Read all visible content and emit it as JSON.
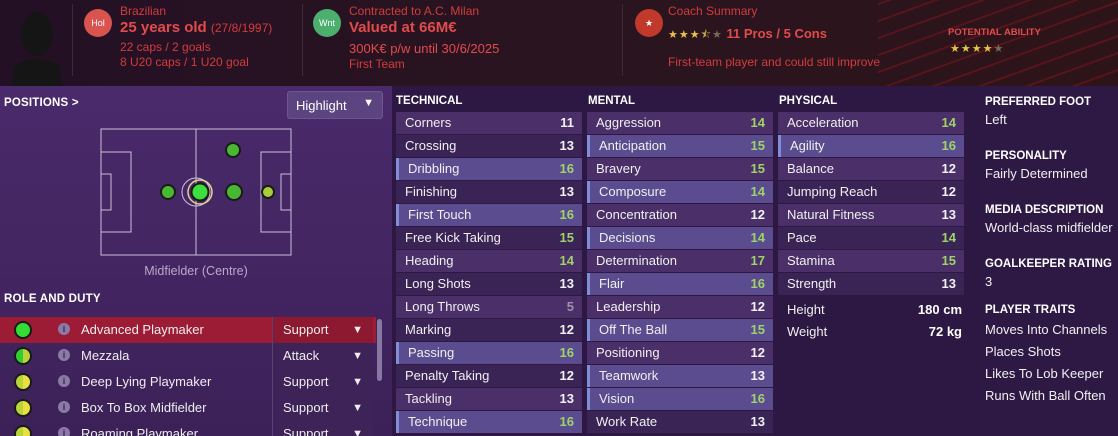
{
  "header": {
    "nation": {
      "badge": "Hol",
      "nationality": "Brazilian",
      "age": "25 years old",
      "dob": "(27/8/1997)",
      "caps": "22 caps / 2 goals",
      "u20": "8 U20 caps / 1 U20 goal"
    },
    "contract": {
      "badge": "Wnt",
      "status": "Contracted to A.C. Milan",
      "value": "Valued at 66M€",
      "wage": "300K€ p/w until 30/6/2025",
      "squad": "First Team"
    },
    "coach": {
      "title": "Coach Summary",
      "stars": 3.5,
      "pros_cons": "11 Pros / 5 Cons",
      "summary": "First-team player and could still improve"
    },
    "potential": {
      "label": "POTENTIAL ABILITY",
      "stars": 4
    },
    "colors": {
      "accent_red": "#e24b4b",
      "nation_badge": "#d9534f",
      "contract_badge": "#4caf6e"
    }
  },
  "positions": {
    "title": "POSITIONS >",
    "highlight_label": "Highlight",
    "caption": "Midfielder (Centre)"
  },
  "role_duty": {
    "title": "ROLE AND DUTY",
    "roles": [
      {
        "name": "Advanced Playmaker",
        "duty": "Support",
        "selected": true
      },
      {
        "name": "Mezzala",
        "duty": "Attack"
      },
      {
        "name": "Deep Lying Playmaker",
        "duty": "Support"
      },
      {
        "name": "Box To Box Midfielder",
        "duty": "Support"
      },
      {
        "name": "Roaming Playmaker",
        "duty": "Support"
      }
    ]
  },
  "attributes": {
    "technical": {
      "title": "TECHNICAL",
      "items": [
        {
          "name": "Corners",
          "value": "11"
        },
        {
          "name": "Crossing",
          "value": "13"
        },
        {
          "name": "Dribbling",
          "value": "16",
          "highlight": true
        },
        {
          "name": "Finishing",
          "value": "13"
        },
        {
          "name": "First Touch",
          "value": "16",
          "highlight": true
        },
        {
          "name": "Free Kick Taking",
          "value": "15"
        },
        {
          "name": "Heading",
          "value": "14"
        },
        {
          "name": "Long Shots",
          "value": "13"
        },
        {
          "name": "Long Throws",
          "value": "5"
        },
        {
          "name": "Marking",
          "value": "12"
        },
        {
          "name": "Passing",
          "value": "16",
          "highlight": true
        },
        {
          "name": "Penalty Taking",
          "value": "12"
        },
        {
          "name": "Tackling",
          "value": "13"
        },
        {
          "name": "Technique",
          "value": "16",
          "highlight": true
        }
      ]
    },
    "mental": {
      "title": "MENTAL",
      "items": [
        {
          "name": "Aggression",
          "value": "14"
        },
        {
          "name": "Anticipation",
          "value": "15",
          "highlight": true
        },
        {
          "name": "Bravery",
          "value": "15"
        },
        {
          "name": "Composure",
          "value": "14",
          "highlight": true
        },
        {
          "name": "Concentration",
          "value": "12"
        },
        {
          "name": "Decisions",
          "value": "14",
          "highlight": true
        },
        {
          "name": "Determination",
          "value": "17"
        },
        {
          "name": "Flair",
          "value": "16",
          "highlight": true
        },
        {
          "name": "Leadership",
          "value": "12"
        },
        {
          "name": "Off The Ball",
          "value": "15",
          "highlight": true
        },
        {
          "name": "Positioning",
          "value": "12"
        },
        {
          "name": "Teamwork",
          "value": "13",
          "highlight": true
        },
        {
          "name": "Vision",
          "value": "16",
          "highlight": true
        },
        {
          "name": "Work Rate",
          "value": "13"
        }
      ]
    },
    "physical": {
      "title": "PHYSICAL",
      "items": [
        {
          "name": "Acceleration",
          "value": "14"
        },
        {
          "name": "Agility",
          "value": "16",
          "highlight": true
        },
        {
          "name": "Balance",
          "value": "12"
        },
        {
          "name": "Jumping Reach",
          "value": "12"
        },
        {
          "name": "Natural Fitness",
          "value": "13"
        },
        {
          "name": "Pace",
          "value": "14"
        },
        {
          "name": "Stamina",
          "value": "15"
        },
        {
          "name": "Strength",
          "value": "13"
        }
      ]
    },
    "height_label": "Height",
    "height": "180 cm",
    "weight_label": "Weight",
    "weight": "72 kg"
  },
  "profile": {
    "preferred_foot_title": "PREFERRED FOOT",
    "preferred_foot": "Left",
    "personality_title": "PERSONALITY",
    "personality": "Fairly Determined",
    "media_title": "MEDIA DESCRIPTION",
    "media": "World-class midfielder",
    "gk_title": "GOALKEEPER RATING",
    "gk": "3",
    "traits_title": "PLAYER TRAITS",
    "traits": [
      "Moves Into Channels",
      "Places Shots",
      "Likes To Lob Keeper",
      "Runs With Ball Often"
    ]
  }
}
